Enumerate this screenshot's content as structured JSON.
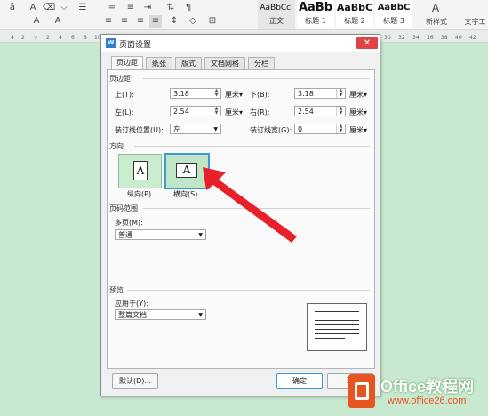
{
  "toolbar": {
    "styles": [
      {
        "sample": "AaBbCcl",
        "label": "正文"
      },
      {
        "sample": "AaBb",
        "label": "标题 1"
      },
      {
        "sample": "AaBbC",
        "label": "标题 2"
      },
      {
        "sample": "AaBbC",
        "label": "标题 3"
      }
    ],
    "new_style": "新样式",
    "text_tool": "文字工"
  },
  "dialog": {
    "title": "页面设置",
    "close": "✕",
    "tabs": [
      "页边距",
      "纸张",
      "版式",
      "文档网格",
      "分栏"
    ],
    "margins": {
      "section": "页边距",
      "top_label": "上(T):",
      "top_value": "3.18",
      "bottom_label": "下(B):",
      "bottom_value": "3.18",
      "left_label": "左(L):",
      "left_value": "2.54",
      "right_label": "右(R):",
      "right_value": "2.54",
      "gutter_pos_label": "装订线位置(U):",
      "gutter_pos_value": "左",
      "gutter_width_label": "装订线宽(G):",
      "gutter_width_value": "0",
      "unit": "厘米"
    },
    "orientation": {
      "section": "方向",
      "portrait": "纵向(P)",
      "landscape": "横向(S)",
      "glyph": "A"
    },
    "pages": {
      "section": "页码范围",
      "multi_label": "多页(M):",
      "multi_value": "普通"
    },
    "preview": {
      "section": "预览",
      "apply_label": "应用于(Y):",
      "apply_value": "整篇文档"
    },
    "buttons": {
      "default": "默认(D)...",
      "ok": "确定",
      "cancel": "取"
    }
  },
  "watermark": {
    "brand": "Office教程网",
    "url": "www.office26.com"
  },
  "colors": {
    "arrow": "#e8202a",
    "selected": "#3c9bd6",
    "brand": "#e6541f"
  }
}
